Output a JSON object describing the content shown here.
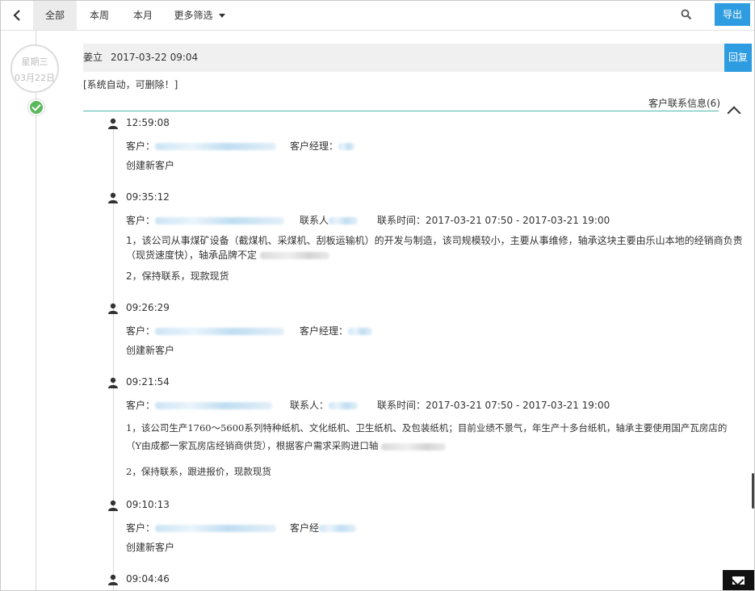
{
  "toolbar": {
    "tabs": [
      "全部",
      "本周",
      "本月"
    ],
    "more_filters": "更多筛选",
    "export_label": "导出"
  },
  "timeline": {
    "weekday": "星期三",
    "date": "03月22日"
  },
  "entry": {
    "author": "姜立",
    "datetime": "2017-03-22 09:04",
    "reply_label": "回复",
    "system_note": "[系统自动，可删除！]",
    "contact_info_title": "客户联系信息(6)"
  },
  "records": [
    {
      "time": "12:59:08",
      "customer_label": "客户：",
      "manager_label": "客户经理：",
      "lines": [
        "创建新客户"
      ]
    },
    {
      "time": "09:35:12",
      "customer_label": "客户：",
      "contact_label": "联系人",
      "contact_time": "联系时间：2017-03-21 07:50 - 2017-03-21 19:00",
      "lines": [
        "1，该公司从事煤矿设备（截煤机、采煤机、刮板运输机）的开发与制造，该司规模较小，主要从事维修，轴承这块主要由乐山本地的经销商负责",
        "（现货速度快），轴承品牌不定",
        "2，保持联系，现款现货"
      ]
    },
    {
      "time": "09:26:29",
      "customer_label": "客户：",
      "manager_label": "客户经理：",
      "lines": [
        "创建新客户"
      ]
    },
    {
      "time": "09:21:54",
      "customer_label": "客户：",
      "contact_label": "联系人：",
      "contact_time": "联系时间：2017-03-21 07:50 - 2017-03-21 19:00",
      "lines": [
        "1，该公司生产1760～5600系列特种纸机、文化纸机、卫生纸机、及包装纸机；目前业绩不景气，年生产十多台纸机，轴承主要使用国产瓦房店的",
        "（Y由成都一家瓦房店经销商供货），根据客户需求采购进口轴",
        "2，保持联系，跟进报价，现款现货"
      ]
    },
    {
      "time": "09:10:13",
      "customer_label": "客户：",
      "manager_label": "客户经",
      "lines": [
        "创建新客户"
      ]
    },
    {
      "time": "09:04:46"
    }
  ]
}
